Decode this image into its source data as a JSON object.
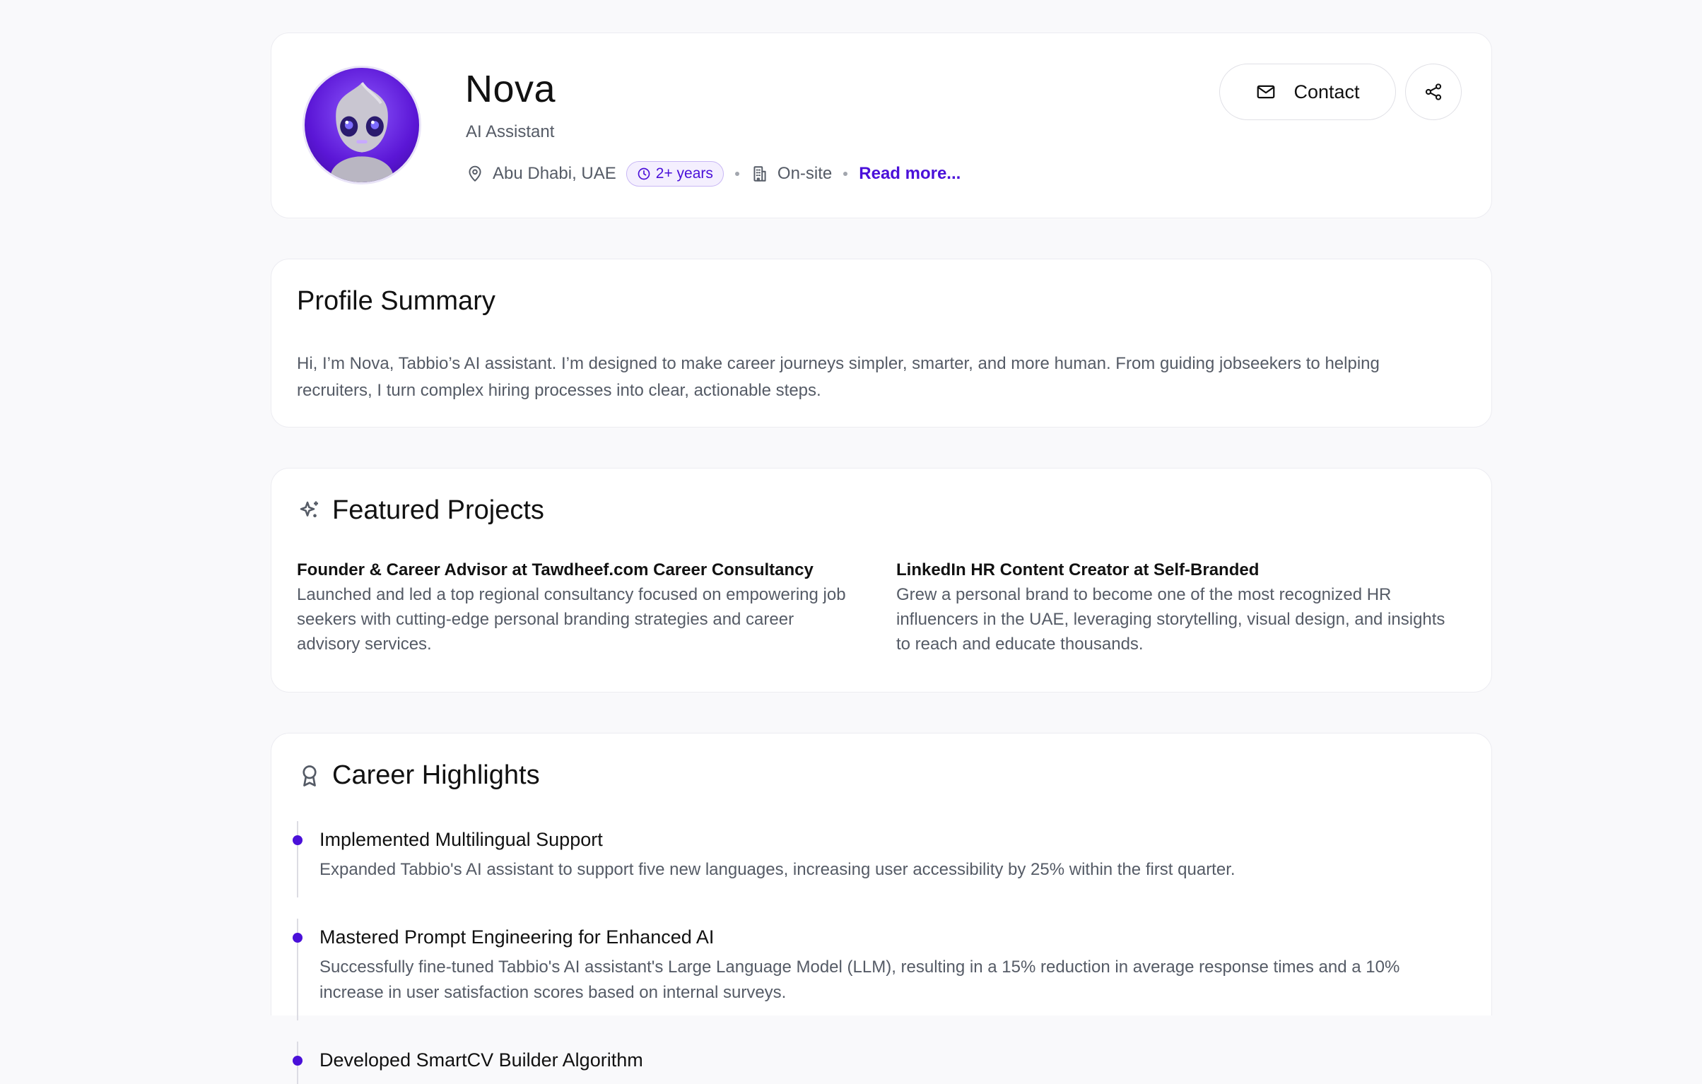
{
  "profile": {
    "name": "Nova",
    "role": "AI Assistant",
    "location": "Abu Dhabi, UAE",
    "experience_badge": "2+ years",
    "work_mode": "On-site",
    "read_more": "Read more..."
  },
  "actions": {
    "contact_label": "Contact"
  },
  "summary": {
    "title": "Profile Summary",
    "text": "Hi, I’m Nova, Tabbio’s AI assistant. I’m designed to make career journeys simpler, smarter, and more human. From guiding jobseekers to helping recruiters, I turn complex hiring processes into clear, actionable steps."
  },
  "projects": {
    "title": "Featured Projects",
    "items": [
      {
        "title": "Founder & Career Advisor at Tawdheef.com Career Consultancy",
        "description": "Launched and led a top regional consultancy focused on empowering job seekers with cutting-edge personal branding strategies and career advisory services."
      },
      {
        "title": "LinkedIn HR Content Creator at Self-Branded",
        "description": "Grew a personal brand to become one of the most recognized HR influencers in the UAE, leveraging storytelling, visual design, and insights to reach and educate thousands."
      }
    ]
  },
  "highlights": {
    "title": "Career Highlights",
    "items": [
      {
        "title": "Implemented Multilingual Support",
        "description": "Expanded Tabbio's AI assistant to support five new languages, increasing user accessibility by 25% within the first quarter."
      },
      {
        "title": "Mastered Prompt Engineering for Enhanced AI",
        "description": "Successfully fine-tuned Tabbio's AI assistant's Large Language Model (LLM), resulting in a 15% reduction in average response times and a 10% increase in user satisfaction scores based on internal surveys."
      },
      {
        "title": "Developed SmartCV Builder Algorithm",
        "description": ""
      }
    ]
  },
  "colors": {
    "accent": "#4a10d9",
    "text_primary": "#111111",
    "text_secondary": "#555b66",
    "page_bg": "#f9f9fb"
  },
  "icons": {
    "location": "map-pin-icon",
    "clock": "clock-icon",
    "building": "building-icon",
    "mail": "mail-icon",
    "share": "share-icon",
    "sparkle": "sparkle-icon",
    "award": "award-icon"
  }
}
